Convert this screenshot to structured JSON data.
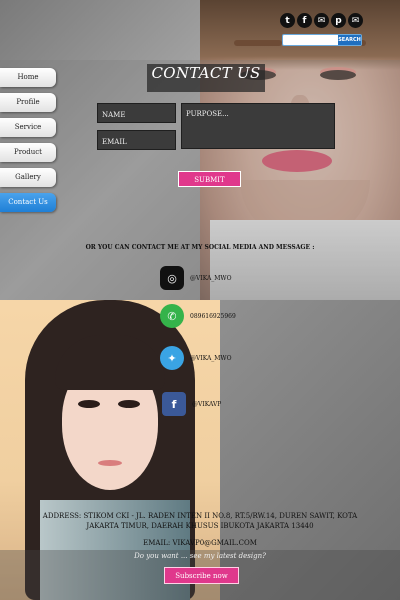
{
  "top_social": {
    "icons": [
      "twitter-icon",
      "facebook-icon",
      "mail-icon",
      "pinterest-icon",
      "message-icon"
    ],
    "search_label": "SEARCH"
  },
  "nav": {
    "items": [
      {
        "label": "Home"
      },
      {
        "label": "Profile"
      },
      {
        "label": "Service"
      },
      {
        "label": "Product"
      },
      {
        "label": "Gallery"
      },
      {
        "label": "Contact Us",
        "active": true
      }
    ]
  },
  "contact": {
    "title": "CONTACT US",
    "name_placeholder": "NAME",
    "email_placeholder": "EMAIL",
    "purpose_placeholder": "PURPOSE...",
    "submit_label": "SUBMIT"
  },
  "social": {
    "heading": "OR YOU CAN CONTACT ME AT MY SOCIAL MEDIA AND MESSAGE :",
    "items": [
      {
        "icon": "instagram-icon",
        "label": "@VIKA_MWO"
      },
      {
        "icon": "whatsapp-icon",
        "label": "089616925969"
      },
      {
        "icon": "twitter-icon",
        "label": "@VIKA_MWO"
      },
      {
        "icon": "facebook-icon",
        "label": "@VIKAVP"
      }
    ]
  },
  "address": "ADDRESS: STIKOM CKI - JL. RADEN INTEN II NO.8, RT.5/RW.14, DUREN SAWIT, KOTA JAKARTA TIMUR, DAERAH KHUSUS IBUKOTA JAKARTA 13440",
  "email": "EMAIL: VIKAVP0@GMAIL.COM",
  "promo": "Do you want ... see my latest design?",
  "subscribe_label": "Subscribe now",
  "colors": {
    "accent": "#e0388c",
    "nav_active": "#1f7fd6"
  }
}
